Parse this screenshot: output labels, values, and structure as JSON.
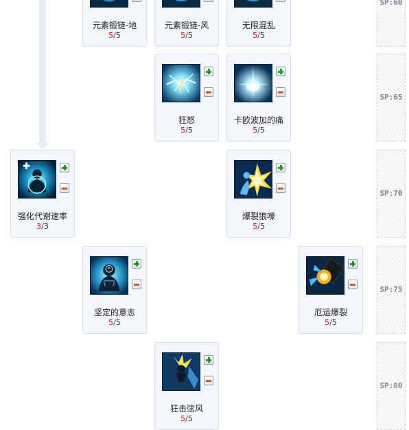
{
  "skills": [
    {
      "id": "chain-earth",
      "name": "元素锻链-地",
      "cur": "5",
      "max": "5",
      "icon": "element-chain-earth-icon"
    },
    {
      "id": "chain-wind",
      "name": "元素锻链-风",
      "cur": "5",
      "max": "5",
      "icon": "element-chain-wind-icon"
    },
    {
      "id": "chaos",
      "name": "无限混乱",
      "cur": "5",
      "max": "5",
      "icon": "infinite-chaos-icon"
    },
    {
      "id": "rage",
      "name": "狂怒",
      "cur": "5",
      "max": "5",
      "icon": "rage-icon"
    },
    {
      "id": "kaobo-pain",
      "name": "卡欧波加的痛",
      "cur": "5",
      "max": "5",
      "icon": "kaobo-pain-icon"
    },
    {
      "id": "metabolism",
      "name": "强化代谢速率",
      "cur": "3",
      "max": "3",
      "icon": "metabolism-icon"
    },
    {
      "id": "burst-howl",
      "name": "爆裂狼嚎",
      "cur": "5",
      "max": "5",
      "icon": "burst-howl-icon"
    },
    {
      "id": "firm-will",
      "name": "坚定的意志",
      "cur": "5",
      "max": "5",
      "icon": "firm-will-icon"
    },
    {
      "id": "doom-burst",
      "name": "厄运爆裂",
      "cur": "5",
      "max": "5",
      "icon": "doom-burst-icon"
    },
    {
      "id": "strike-wind",
      "name": "狂击弦风",
      "cur": "5",
      "max": "5",
      "icon": "strike-wind-icon"
    }
  ],
  "sp_labels": [
    "SP:60",
    "SP:65",
    "SP:70",
    "SP:75",
    "SP:80"
  ],
  "buttons": {
    "plus_icon": "plus-icon",
    "minus_icon": "minus-icon"
  },
  "colors": {
    "current_level": "#cc1111",
    "panel_bg": "#f3f6fb",
    "panel_border": "#d6e0ec",
    "connector": "#e6edf5"
  }
}
